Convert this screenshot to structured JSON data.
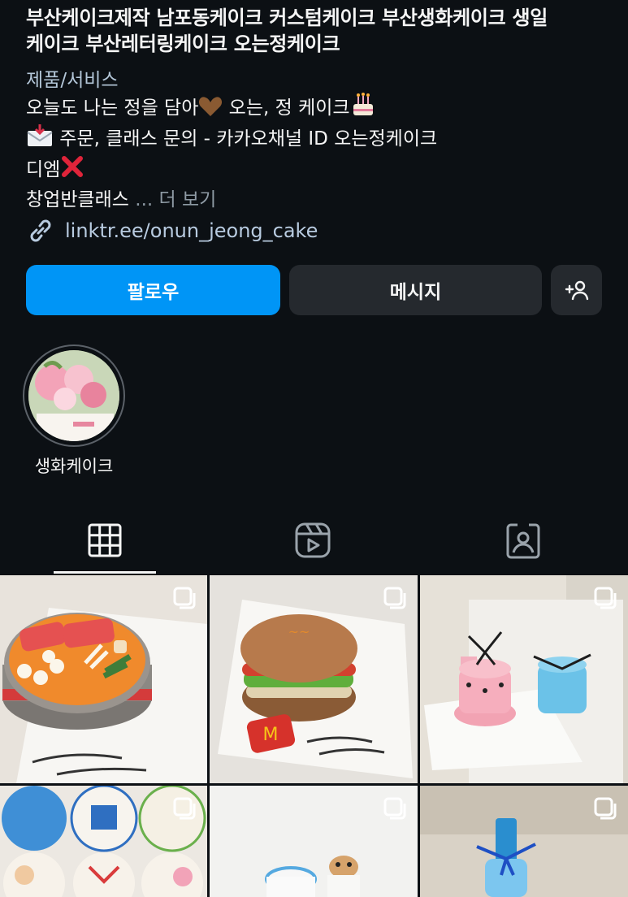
{
  "profile": {
    "name_line1": "부산케이크제작 남포동케이크 커스텀케이크 부산생화케이크 생일",
    "name_line2": "케이크 부산레터링케이크 오는정케이크",
    "category": "제품/서비스",
    "bio_line1": "오늘도 나는 정을 담아",
    "bio_line1b": " 오는, 정 케이크",
    "bio_line2": " 주문, 클래스 문의 - 카카오채널 ID 오는정케이크",
    "bio_line3": "디엠",
    "bio_line4": "창업반클래스",
    "more": " ... 더 보기",
    "link": "linktr.ee/onun_jeong_cake"
  },
  "buttons": {
    "follow": "팔로우",
    "message": "메시지",
    "add_person": "+"
  },
  "highlight": {
    "label": "생화케이크"
  },
  "tabs": [
    {
      "name": "grid",
      "icon": "grid-icon",
      "active": true
    },
    {
      "name": "reels",
      "icon": "reels-icon",
      "active": false
    },
    {
      "name": "tagged",
      "icon": "tagged-icon",
      "active": false
    }
  ],
  "posts": [
    {
      "theme": "grilled-meat-cake",
      "multi": true
    },
    {
      "theme": "burger-cake",
      "multi": true
    },
    {
      "theme": "pink-blue-tier-cakes",
      "multi": true
    },
    {
      "theme": "letter-cakes-collage",
      "multi": true
    },
    {
      "theme": "small-cakes-dog",
      "multi": true
    },
    {
      "theme": "soju-bottle-cake",
      "multi": true
    }
  ],
  "colors": {
    "background": "#0c1014",
    "follow_button": "#0095f6",
    "secondary_button": "#25292e",
    "link": "#b8cbe0",
    "category": "#b4c7d9"
  }
}
